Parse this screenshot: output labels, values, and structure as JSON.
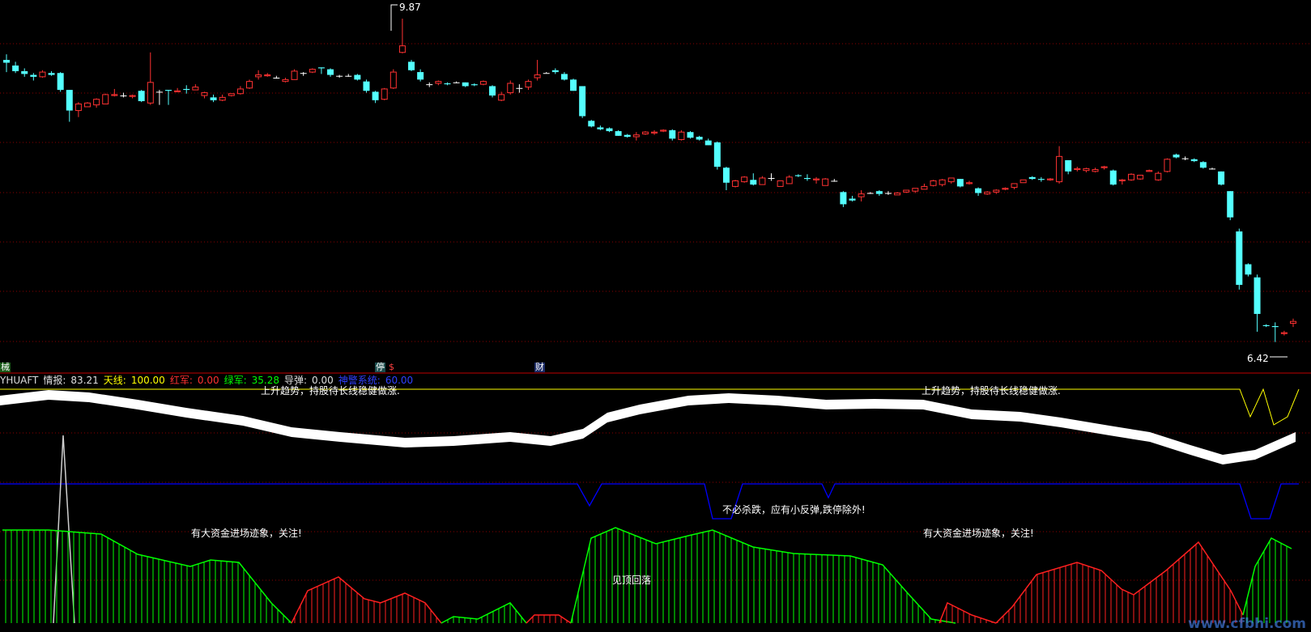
{
  "indicator": {
    "name": "YHUAFT",
    "fields": [
      {
        "label": "情报:",
        "value": "83.21",
        "color": "#e0e0e0"
      },
      {
        "label": "天线:",
        "value": "100.00",
        "color": "#ffff00"
      },
      {
        "label": "红军:",
        "value": "0.00",
        "color": "#ff3030"
      },
      {
        "label": "绿军:",
        "value": "35.28",
        "color": "#00ff00"
      },
      {
        "label": "导弹:",
        "value": "0.00",
        "color": "#e0e0e0"
      },
      {
        "label": "神警系统:",
        "value": "60.00",
        "color": "#3040ff"
      }
    ]
  },
  "markers": {
    "left": "械",
    "mid_a": "停",
    "mid_b": "$",
    "mid_c": "财"
  },
  "annotations": {
    "top_left": "上升趋势，持股待长线稳健做涨.",
    "top_right": "上升趋势，持股待长线稳健做涨.",
    "mid": "不必杀跌，应有小反弹,跌停除外!",
    "capital_left": "有大资金进场迹象，关注!",
    "capital_right": "有大资金进场迹象，关注!",
    "top_warn": "见顶回落"
  },
  "price_labels": {
    "high": "9.87",
    "low": "6.42"
  },
  "watermark": "www.cfbhi.com",
  "colors": {
    "up": "#ff3232",
    "down": "#54ffff",
    "doji": "#ffffff",
    "green": "#00ff00",
    "red": "#ff2020",
    "blue": "#0000ff",
    "yellow": "#ffff00",
    "grid": "#8b0000",
    "divider": "#c00000"
  },
  "chart_data": {
    "type": "candlestick",
    "series": [
      {
        "name": "candles",
        "ohlc": [
          [
            9.43,
            9.49,
            9.3,
            9.4
          ],
          [
            9.37,
            9.41,
            9.29,
            9.31
          ],
          [
            9.31,
            9.34,
            9.25,
            9.28
          ],
          [
            9.27,
            9.29,
            9.21,
            9.25
          ],
          [
            9.25,
            9.32,
            9.24,
            9.3
          ],
          [
            9.29,
            9.31,
            9.26,
            9.27
          ],
          [
            9.29,
            9.3,
            9.09,
            9.11
          ],
          [
            9.11,
            9.11,
            8.77,
            8.89
          ],
          [
            8.89,
            8.98,
            8.82,
            8.96
          ],
          [
            8.93,
            8.98,
            8.93,
            8.97
          ],
          [
            8.95,
            9.02,
            8.92,
            9.01
          ],
          [
            8.96,
            9.07,
            8.96,
            9.06
          ],
          [
            9.05,
            9.12,
            9.04,
            9.06
          ],
          [
            9.05,
            9.08,
            9.03,
            9.05
          ],
          [
            9.04,
            9.06,
            9.02,
            9.05
          ],
          [
            9.1,
            9.11,
            8.98,
            8.99
          ],
          [
            8.97,
            9.51,
            8.95,
            9.19
          ],
          [
            9.09,
            9.11,
            8.95,
            9.09
          ],
          [
            9.11,
            9.11,
            8.95,
            9.1
          ],
          [
            9.09,
            9.13,
            9.09,
            9.1
          ],
          [
            9.12,
            9.16,
            9.07,
            9.11
          ],
          [
            9.11,
            9.17,
            9.11,
            9.14
          ],
          [
            9.05,
            9.09,
            9.02,
            9.08
          ],
          [
            9.03,
            9.06,
            8.98,
            9.0
          ],
          [
            9.0,
            9.06,
            8.99,
            9.03
          ],
          [
            9.05,
            9.07,
            9.04,
            9.07
          ],
          [
            9.07,
            9.15,
            9.06,
            9.12
          ],
          [
            9.13,
            9.22,
            9.12,
            9.2
          ],
          [
            9.25,
            9.32,
            9.22,
            9.27
          ],
          [
            9.26,
            9.29,
            9.25,
            9.27
          ],
          [
            9.24,
            9.26,
            9.23,
            9.24
          ],
          [
            9.2,
            9.24,
            9.19,
            9.22
          ],
          [
            9.22,
            9.33,
            9.22,
            9.31
          ],
          [
            9.29,
            9.3,
            9.26,
            9.29
          ],
          [
            9.3,
            9.34,
            9.29,
            9.33
          ],
          [
            9.35,
            9.35,
            9.28,
            9.34
          ],
          [
            9.33,
            9.34,
            9.25,
            9.27
          ],
          [
            9.26,
            9.27,
            9.24,
            9.26
          ],
          [
            9.26,
            9.28,
            9.25,
            9.26
          ],
          [
            9.27,
            9.28,
            9.21,
            9.22
          ],
          [
            9.2,
            9.22,
            9.08,
            9.1
          ],
          [
            9.09,
            9.1,
            8.97,
            9.0
          ],
          [
            9.01,
            9.13,
            9.0,
            9.12
          ],
          [
            9.13,
            9.33,
            9.12,
            9.3
          ],
          [
            9.51,
            9.87,
            9.5,
            9.58
          ],
          [
            9.41,
            9.43,
            9.31,
            9.32
          ],
          [
            9.3,
            9.33,
            9.2,
            9.22
          ],
          [
            9.17,
            9.19,
            9.14,
            9.17
          ],
          [
            9.18,
            9.21,
            9.16,
            9.2
          ],
          [
            9.18,
            9.19,
            9.16,
            9.17
          ],
          [
            9.19,
            9.2,
            9.18,
            9.19
          ],
          [
            9.19,
            9.19,
            9.14,
            9.15
          ],
          [
            9.17,
            9.18,
            9.15,
            9.16
          ],
          [
            9.17,
            9.21,
            9.16,
            9.2
          ],
          [
            9.15,
            9.16,
            9.03,
            9.05
          ],
          [
            9.0,
            9.09,
            8.99,
            9.06
          ],
          [
            9.08,
            9.21,
            9.06,
            9.18
          ],
          [
            9.13,
            9.17,
            9.08,
            9.13
          ],
          [
            9.14,
            9.22,
            9.11,
            9.2
          ],
          [
            9.24,
            9.43,
            9.21,
            9.27
          ],
          [
            9.29,
            9.3,
            9.29,
            9.29
          ],
          [
            9.32,
            9.34,
            9.28,
            9.3
          ],
          [
            9.28,
            9.3,
            9.21,
            9.22
          ],
          [
            9.22,
            9.23,
            9.1,
            9.1
          ],
          [
            9.15,
            9.15,
            8.81,
            8.83
          ],
          [
            8.78,
            8.79,
            8.71,
            8.72
          ],
          [
            8.71,
            8.73,
            8.68,
            8.69
          ],
          [
            8.7,
            8.71,
            8.66,
            8.67
          ],
          [
            8.67,
            8.68,
            8.62,
            8.62
          ],
          [
            8.63,
            8.64,
            8.6,
            8.61
          ],
          [
            8.61,
            8.66,
            8.57,
            8.63
          ],
          [
            8.64,
            8.67,
            8.63,
            8.66
          ],
          [
            8.65,
            8.68,
            8.63,
            8.66
          ],
          [
            8.67,
            8.69,
            8.66,
            8.68
          ],
          [
            8.68,
            8.69,
            8.57,
            8.59
          ],
          [
            8.58,
            8.68,
            8.57,
            8.66
          ],
          [
            8.66,
            8.67,
            8.59,
            8.6
          ],
          [
            8.61,
            8.62,
            8.57,
            8.58
          ],
          [
            8.57,
            8.59,
            8.52,
            8.52
          ],
          [
            8.55,
            8.56,
            8.26,
            8.29
          ],
          [
            8.28,
            8.29,
            8.04,
            8.12
          ],
          [
            8.08,
            8.15,
            8.07,
            8.14
          ],
          [
            8.13,
            8.19,
            8.12,
            8.18
          ],
          [
            8.15,
            8.22,
            8.09,
            8.1
          ],
          [
            8.1,
            8.19,
            8.1,
            8.17
          ],
          [
            8.17,
            8.22,
            8.14,
            8.17
          ],
          [
            8.08,
            8.14,
            8.08,
            8.14
          ],
          [
            8.11,
            8.2,
            8.11,
            8.18
          ],
          [
            8.2,
            8.21,
            8.18,
            8.19
          ],
          [
            8.17,
            8.21,
            8.14,
            8.16
          ],
          [
            8.15,
            8.18,
            8.11,
            8.16
          ],
          [
            8.09,
            8.17,
            8.09,
            8.16
          ],
          [
            8.14,
            8.16,
            8.13,
            8.14
          ],
          [
            8.02,
            8.03,
            7.86,
            7.89
          ],
          [
            7.95,
            7.98,
            7.92,
            7.93
          ],
          [
            7.97,
            8.04,
            7.92,
            8.0
          ],
          [
            8.01,
            8.02,
            8.0,
            8.01
          ],
          [
            8.03,
            8.04,
            7.98,
            8.0
          ],
          [
            8.01,
            8.03,
            7.99,
            8.01
          ],
          [
            7.99,
            8.02,
            7.99,
            8.01
          ],
          [
            8.02,
            8.04,
            8.01,
            8.04
          ],
          [
            8.03,
            8.06,
            8.01,
            8.06
          ],
          [
            8.05,
            8.11,
            8.05,
            8.08
          ],
          [
            8.09,
            8.15,
            8.08,
            8.14
          ],
          [
            8.1,
            8.16,
            8.08,
            8.15
          ],
          [
            8.13,
            8.17,
            8.11,
            8.17
          ],
          [
            8.16,
            8.16,
            8.07,
            8.08
          ],
          [
            8.11,
            8.14,
            8.1,
            8.12
          ],
          [
            8.06,
            8.07,
            7.98,
            8.01
          ],
          [
            8.0,
            8.03,
            7.99,
            8.02
          ],
          [
            8.02,
            8.05,
            8.0,
            8.04
          ],
          [
            8.05,
            8.07,
            8.04,
            8.06
          ],
          [
            8.07,
            8.11,
            8.05,
            8.11
          ],
          [
            8.12,
            8.15,
            8.12,
            8.15
          ],
          [
            8.18,
            8.19,
            8.15,
            8.16
          ],
          [
            8.16,
            8.18,
            8.13,
            8.15
          ],
          [
            8.15,
            8.17,
            8.14,
            8.16
          ],
          [
            8.13,
            8.51,
            8.11,
            8.4
          ],
          [
            8.36,
            8.36,
            8.21,
            8.24
          ],
          [
            8.26,
            8.29,
            8.24,
            8.27
          ],
          [
            8.25,
            8.28,
            8.23,
            8.27
          ],
          [
            8.24,
            8.28,
            8.23,
            8.26
          ],
          [
            8.28,
            8.3,
            8.26,
            8.29
          ],
          [
            8.25,
            8.26,
            8.09,
            8.1
          ],
          [
            8.14,
            8.16,
            8.1,
            8.15
          ],
          [
            8.15,
            8.22,
            8.14,
            8.21
          ],
          [
            8.16,
            8.2,
            8.15,
            8.2
          ],
          [
            8.24,
            8.26,
            8.24,
            8.25
          ],
          [
            8.15,
            8.24,
            8.14,
            8.22
          ],
          [
            8.24,
            8.38,
            8.23,
            8.37
          ],
          [
            8.42,
            8.43,
            8.38,
            8.39
          ],
          [
            8.38,
            8.4,
            8.36,
            8.38
          ],
          [
            8.37,
            8.38,
            8.34,
            8.35
          ],
          [
            8.34,
            8.35,
            8.27,
            8.28
          ],
          [
            8.27,
            8.28,
            8.26,
            8.27
          ],
          [
            8.24,
            8.24,
            8.09,
            8.1
          ],
          [
            8.03,
            8.03,
            7.72,
            7.75
          ],
          [
            7.6,
            7.63,
            6.98,
            7.03
          ],
          [
            7.25,
            7.26,
            7.12,
            7.14
          ],
          [
            7.11,
            7.14,
            6.53,
            6.72
          ],
          [
            6.6,
            6.61,
            6.58,
            6.59
          ],
          [
            6.59,
            6.63,
            6.42,
            6.58
          ],
          [
            6.51,
            6.54,
            6.49,
            6.52
          ],
          [
            6.62,
            6.67,
            6.58,
            6.64
          ]
        ]
      }
    ],
    "ylim": [
      6.4,
      10.0
    ]
  }
}
